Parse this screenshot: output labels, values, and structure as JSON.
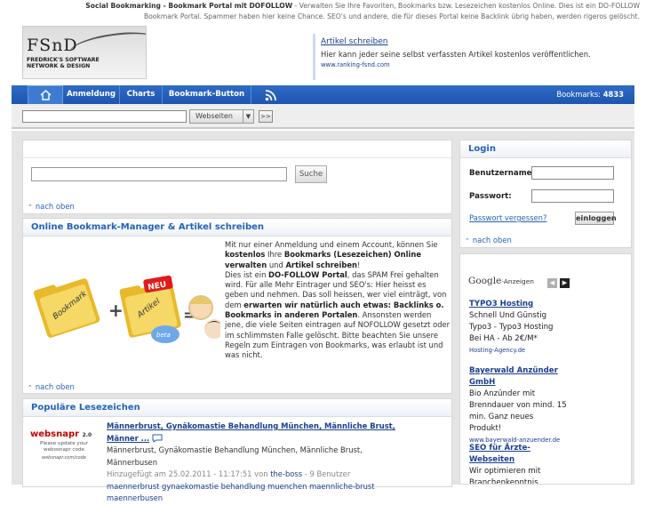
{
  "header": {
    "title_strong": "Social Bookmarking - Bookmark Portal mit DOFOLLOW",
    "title_desc": " - Verwalten Sie Ihre Favoriten, Bookmarks bzw. Lesezeichen kostenlos Online. Dies ist ein DO-FOLLOW Bookmark Portal. Spammer haben hier keine Chance. SEO's und andere, die für dieses Portal keine Backlink übrig haben, werden rigeros gelöscht.",
    "logo_big": "FSnD",
    "logo_small_1": "FREDRICK'S SOFTWARE",
    "logo_small_2": "NETWORK & DESIGN"
  },
  "top_ad": {
    "title": "Artikel schreiben",
    "desc": "Hier kann jeder seine selbst verfassten Artikel kostenlos veröffentlichen.",
    "url": "www.ranking-fsnd.com"
  },
  "nav": {
    "home_icon": "home-icon",
    "items": [
      "Anmeldung",
      "Charts",
      "Bookmark-Button"
    ],
    "rss_icon": "rss-icon",
    "count_label": "Bookmarks:",
    "count_value": "4833"
  },
  "searchbar": {
    "input_value": "",
    "select_value": "Webseiten",
    "go_label": ">>"
  },
  "main_search": {
    "input_value": "",
    "button_label": "Suche",
    "nach_oben": "nach oben"
  },
  "bookmark_manager": {
    "heading": "Online Bookmark-Manager & Artikel schreiben",
    "p1": "Mit nur einer Anmeldung und einem Account, können Sie ",
    "p1_b1": "kostenlos",
    "p1_b": " Ihre ",
    "p1_b2": "Bookmarks (Lesezeichen) Online verwalten",
    "p1_c": " und ",
    "p1_b3": "Artikel schreiben",
    "p1_d": "!",
    "p2": "Dies ist ein ",
    "p2_b1": "DO-FOLLOW Portal",
    "p2_c": ", das SPAM Frei gehalten wird. Für alle Mehr Eintrager und SEO's: Hier heisst es geben und nehmen. Das soll heissen, wer viel einträgt, von dem ",
    "p2_b2": "erwarten wir natürlich auch etwas: Backlinks o. Bookmarks in anderen Portalen",
    "p2_d": ". Ansonsten werden jene, die viele Seiten eintragen auf NOFOLLOW gesetzt oder im schlimmsten Falle gelöscht. Bitte beachten Sie unsere Regeln zum Eintragen von Bookmarks, was erlaubt ist und was nicht.",
    "graphic_bookmark": "Bookmark",
    "graphic_artikel": "Artikel",
    "graphic_neu": "NEU",
    "graphic_beta": "beta",
    "plus": "+",
    "equals": "=",
    "nach_oben": "nach oben"
  },
  "popular": {
    "heading": "Populäre Lesezeichen",
    "logo_text": "websnapr",
    "logo_ver": "2.0",
    "logo_note": "Please update your webosnapr code",
    "logo_url": "websnapr.com/code",
    "entry_title": "Männerbrust, Gynäkomastie Behandlung München, Männliche Brust, Männer ...",
    "entry_desc": "Männerbrust, Gynäkomastie Behandlung München, Männliche Brust, Männerbusen",
    "entry_meta_prefix": "Hinzugefügt am 25.02.2011 - 11:17:51 von ",
    "entry_user": "the-boss",
    "entry_meta_suffix": " - 9 Benutzer",
    "entry_tags": "maennerbrust gynaekomastie behandlung muenchen maennliche-brust maennerbusen"
  },
  "login": {
    "heading": "Login",
    "username_label": "Benutzername:",
    "password_label": "Passwort:",
    "username_value": "",
    "password_value": "",
    "forgot": "Passwort vergessen?",
    "button": "einloggen",
    "nach_oben": "nach oben"
  },
  "google_ads": {
    "brand": "Google",
    "label": "-Anzeigen",
    "ads": [
      {
        "title": "TYPO3 Hosting",
        "desc": "Schnell Und Günstig Typo3 - Typo3 Hosting Bei HA - Ab 2€/M*",
        "url": "Hosting-Agency.de"
      },
      {
        "title": "Bayerwald Anzünder GmbH",
        "desc": "Bio Anzünder mit Brenndauer von mind. 15 min. Ganz neues Produkt!",
        "url": "www.bayerwald-anzuender.de"
      },
      {
        "title": "SEO für Ärzte-Webseiten",
        "desc": "Wir optimieren mit Branchenkenntnis",
        "url": ""
      }
    ]
  },
  "colors": {
    "nav_blue": "#1d56b0",
    "link_blue": "#2463b8",
    "accent_red": "#c40000"
  }
}
